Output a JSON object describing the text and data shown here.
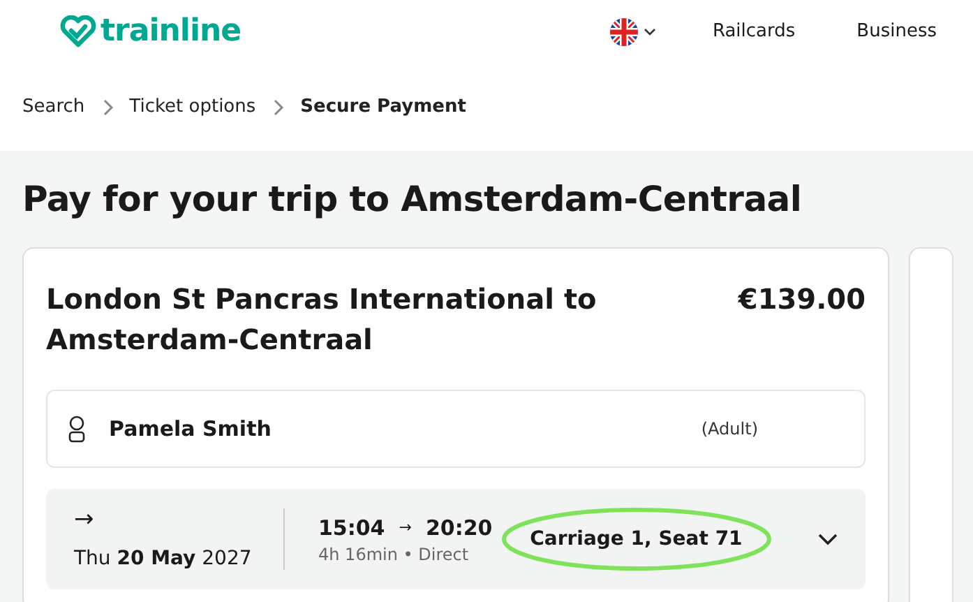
{
  "header": {
    "logo": "trainline",
    "nav": [
      "Railcards",
      "Business"
    ]
  },
  "breadcrumb": [
    {
      "label": "Search",
      "current": false
    },
    {
      "label": "Ticket options",
      "current": false
    },
    {
      "label": "Secure Payment",
      "current": true
    }
  ],
  "title": "Pay for your trip to Amsterdam-Centraal",
  "trip": {
    "route": "London St Pancras International to Amsterdam-Centraal",
    "price": "€139.00",
    "passenger": {
      "name": "Pamela Smith",
      "type": "(Adult)"
    },
    "journey": {
      "direction": "→",
      "date": "Thu **20 May** 2027",
      "depart": "15:04",
      "arrow": "→",
      "arrive": "20:20",
      "details": "4h 16min • Direct",
      "seat": "Carriage 1, Seat 71",
      "seat_highlighted": true
    }
  }
}
